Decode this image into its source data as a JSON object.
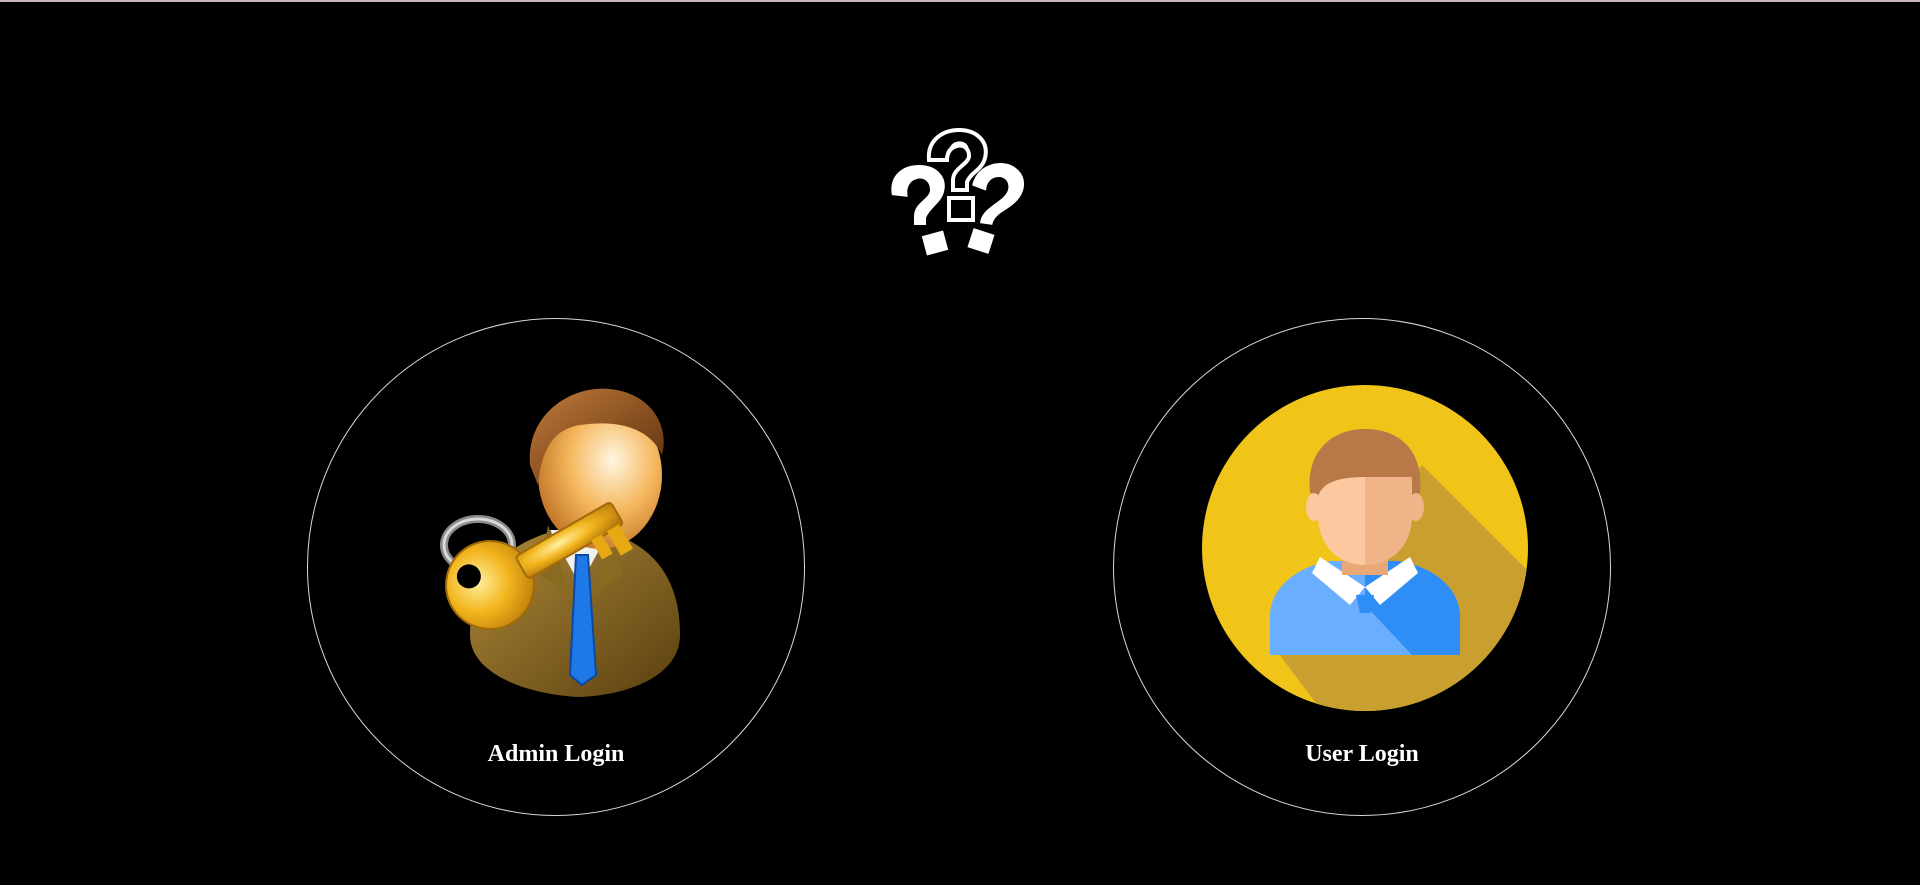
{
  "header": {
    "logo_icon": "question-marks-icon"
  },
  "login_options": [
    {
      "label": "Admin Login",
      "icon": "admin-key-avatar-icon"
    },
    {
      "label": "User Login",
      "icon": "user-avatar-icon"
    }
  ],
  "colors": {
    "background": "#000000",
    "circle_border": "#d9d9d9",
    "label_text": "#ffffff",
    "user_avatar_bg": "#f0c419",
    "user_shirt": "#2f8ef5",
    "admin_key": "#f2b51d"
  }
}
